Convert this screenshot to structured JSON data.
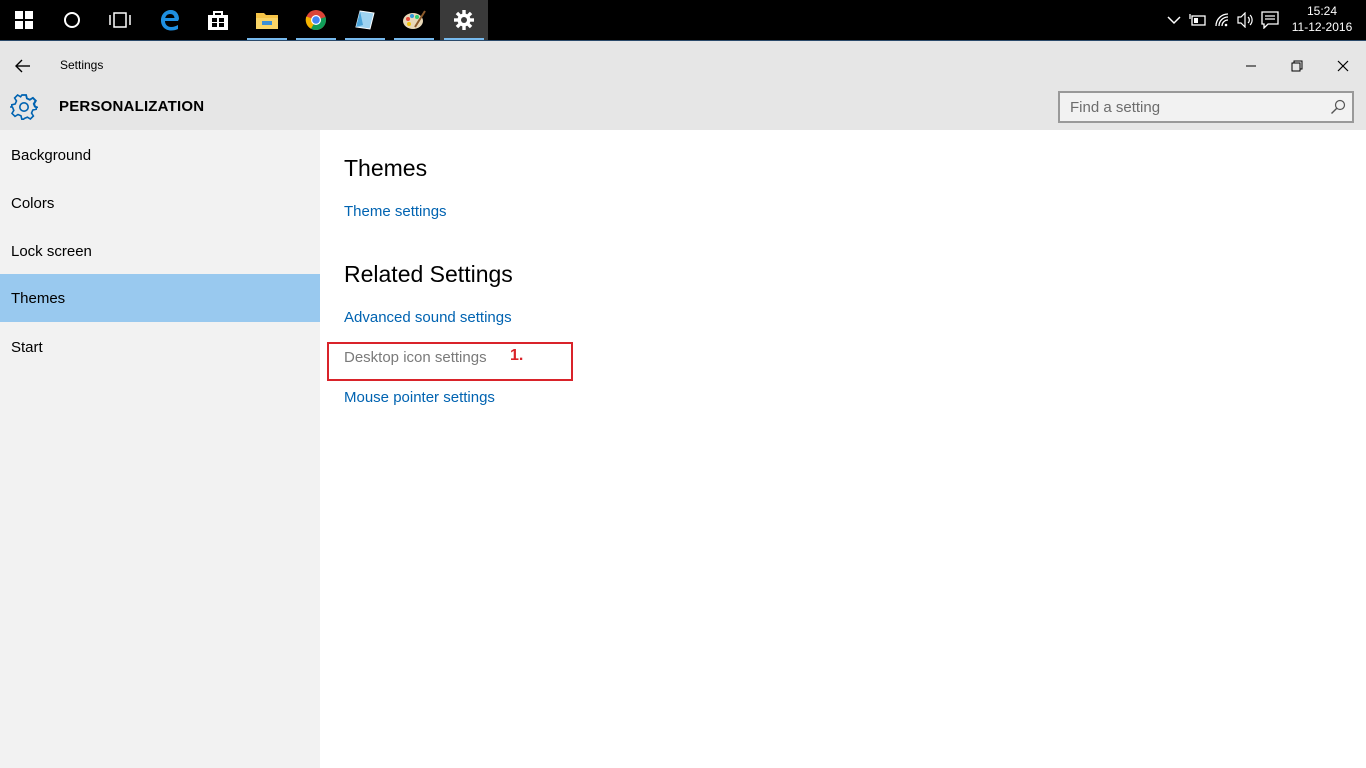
{
  "taskbar": {
    "items": [
      {
        "name": "start-button-icon"
      },
      {
        "name": "cortana-icon"
      },
      {
        "name": "task-view-icon"
      },
      {
        "name": "edge-browser-icon"
      },
      {
        "name": "store-icon"
      },
      {
        "name": "file-explorer-icon"
      },
      {
        "name": "chrome-icon"
      },
      {
        "name": "app-icon"
      },
      {
        "name": "paint-icon"
      },
      {
        "name": "settings-app-icon"
      }
    ],
    "tray": [
      "chevron-up-icon",
      "battery-icon",
      "wifi-icon",
      "volume-icon",
      "notification-icon"
    ],
    "clock": {
      "time": "15:24",
      "date": "11-12-2016"
    }
  },
  "window": {
    "title": "Settings",
    "heading": "PERSONALIZATION",
    "search": {
      "placeholder": "Find a setting"
    }
  },
  "sidebar": {
    "items": [
      {
        "label": "Background",
        "selected": false
      },
      {
        "label": "Colors",
        "selected": false
      },
      {
        "label": "Lock screen",
        "selected": false
      },
      {
        "label": "Themes",
        "selected": true
      },
      {
        "label": "Start",
        "selected": false
      }
    ]
  },
  "main": {
    "themes": {
      "title": "Themes",
      "link": "Theme settings"
    },
    "related": {
      "title": "Related Settings",
      "links": [
        "Advanced sound settings",
        "Desktop icon settings",
        "Mouse pointer settings"
      ]
    },
    "annotation": "1."
  },
  "colors": {
    "accent": "#0063b1",
    "selected_nav": "#99c9ef",
    "annotation": "#d9232a"
  }
}
